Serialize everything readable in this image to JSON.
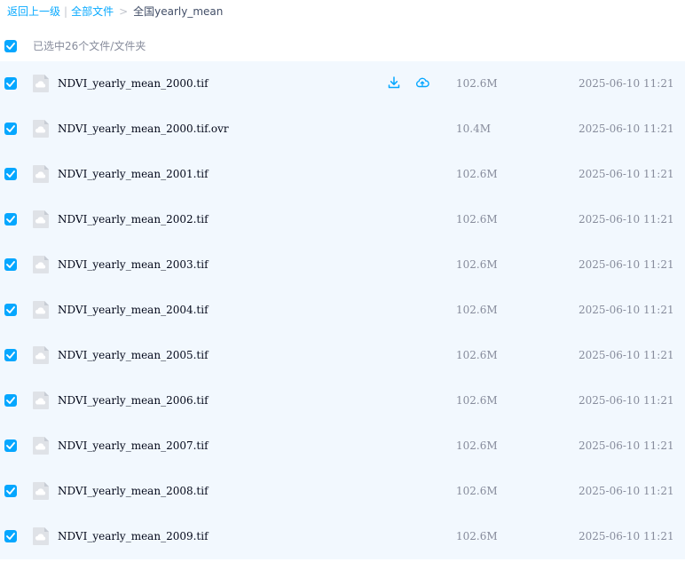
{
  "breadcrumb": {
    "back": "返回上一级",
    "divider": "|",
    "all_files": "全部文件",
    "arrow": ">",
    "current": "全国yearly_mean"
  },
  "selection": {
    "text": "已选中26个文件/文件夹"
  },
  "icons": {
    "checkbox": "checkmark-icon",
    "file": "cloud-file-icon",
    "download": "download-icon",
    "cloud_save": "cloud-upload-icon"
  },
  "colors": {
    "accent": "#06a7ff",
    "row_selected_bg": "#f2f8fe",
    "muted_text": "#878c9c"
  },
  "files": [
    {
      "name": "NDVI_yearly_mean_2000.tif",
      "size": "102.6M",
      "time": "2025-06-10 11:21"
    },
    {
      "name": "NDVI_yearly_mean_2000.tif.ovr",
      "size": "10.4M",
      "time": "2025-06-10 11:21"
    },
    {
      "name": "NDVI_yearly_mean_2001.tif",
      "size": "102.6M",
      "time": "2025-06-10 11:21"
    },
    {
      "name": "NDVI_yearly_mean_2002.tif",
      "size": "102.6M",
      "time": "2025-06-10 11:21"
    },
    {
      "name": "NDVI_yearly_mean_2003.tif",
      "size": "102.6M",
      "time": "2025-06-10 11:21"
    },
    {
      "name": "NDVI_yearly_mean_2004.tif",
      "size": "102.6M",
      "time": "2025-06-10 11:21"
    },
    {
      "name": "NDVI_yearly_mean_2005.tif",
      "size": "102.6M",
      "time": "2025-06-10 11:21"
    },
    {
      "name": "NDVI_yearly_mean_2006.tif",
      "size": "102.6M",
      "time": "2025-06-10 11:21"
    },
    {
      "name": "NDVI_yearly_mean_2007.tif",
      "size": "102.6M",
      "time": "2025-06-10 11:21"
    },
    {
      "name": "NDVI_yearly_mean_2008.tif",
      "size": "102.6M",
      "time": "2025-06-10 11:21"
    },
    {
      "name": "NDVI_yearly_mean_2009.tif",
      "size": "102.6M",
      "time": "2025-06-10 11:21"
    }
  ]
}
